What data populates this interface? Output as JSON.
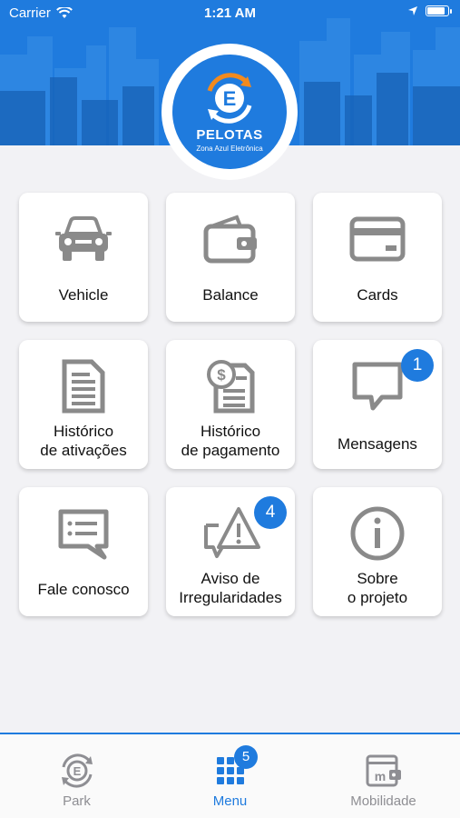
{
  "status_bar": {
    "carrier": "Carrier",
    "time": "1:21 AM",
    "battery_level": 0.9
  },
  "logo": {
    "city": "PELOTAS",
    "subtitle": "Zona Azul Eletrônica",
    "letter": "E"
  },
  "menu": {
    "vehicle": {
      "label": "Vehicle",
      "icon": "car-icon"
    },
    "balance": {
      "label": "Balance",
      "icon": "wallet-icon"
    },
    "cards": {
      "label": "Cards",
      "icon": "credit-card-icon"
    },
    "activation_history": {
      "line1": "Histórico",
      "line2": "de ativações",
      "icon": "document-icon"
    },
    "payment_history": {
      "line1": "Histórico",
      "line2": "de pagamento",
      "icon": "payment-document-icon"
    },
    "messages": {
      "label": "Mensagens",
      "badge": "1",
      "icon": "chat-bubble-icon"
    },
    "contact": {
      "label": "Fale conosco",
      "icon": "message-lines-icon"
    },
    "irregularities": {
      "line1": "Aviso de",
      "line2": "Irregularidades",
      "badge": "4",
      "icon": "warning-icon"
    },
    "about": {
      "line1": "Sobre",
      "line2": "o projeto",
      "icon": "info-icon"
    }
  },
  "tabs": {
    "park": {
      "label": "Park",
      "icon": "park-logo-icon"
    },
    "menu": {
      "label": "Menu",
      "badge": "5",
      "icon": "grid-icon"
    },
    "mobility": {
      "label": "Mobilidade",
      "icon": "mobility-card-icon"
    }
  },
  "colors": {
    "accent": "#1f7bde",
    "icon_gray": "#8a8a8a",
    "background": "#f2f2f5"
  }
}
